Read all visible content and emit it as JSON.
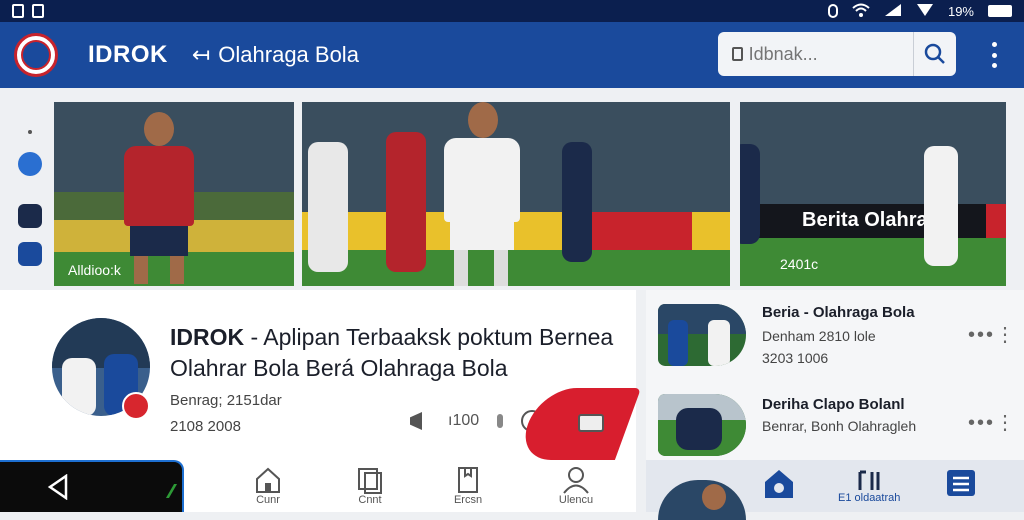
{
  "status_bar": {
    "left_icons": "status-icons",
    "battery": "19%"
  },
  "app_bar": {
    "title": "IDROK",
    "subtitle": "Olahraga Bola",
    "search_placeholder": "Idbnak...",
    "brand_color": "#1a4a9c"
  },
  "hero_cards": [
    {
      "label": "Alldioo:k"
    },
    {
      "label": ""
    },
    {
      "label": "2401c",
      "banner": "Berita  Olahragy"
    }
  ],
  "featured": {
    "title_bold": "IDROK",
    "title_rest": " - Aplipan Terbaaksk poktum Bernea Olahrar Bola Berá Olahraga Bola",
    "meta": "Benrag; 2151dar",
    "time": "2108 2008",
    "actions": {
      "count": "ı100"
    }
  },
  "news_list": [
    {
      "title": "Beria - Olahraga Bola",
      "sub": "Denham 2810 lole",
      "time": "3203 1006"
    },
    {
      "title": "Deriha Clapo Bolanl",
      "sub": "Benrar, Bonh Olahragleh",
      "time": ""
    }
  ],
  "bottom_nav": [
    {
      "label": "Cunr"
    },
    {
      "label": "Cnnt"
    },
    {
      "label": "Ercsn"
    },
    {
      "label": "Ulencu"
    }
  ],
  "bottom_nav_right": [
    {
      "label": ""
    },
    {
      "label": "E1 oldaatrah"
    },
    {
      "label": ""
    }
  ]
}
